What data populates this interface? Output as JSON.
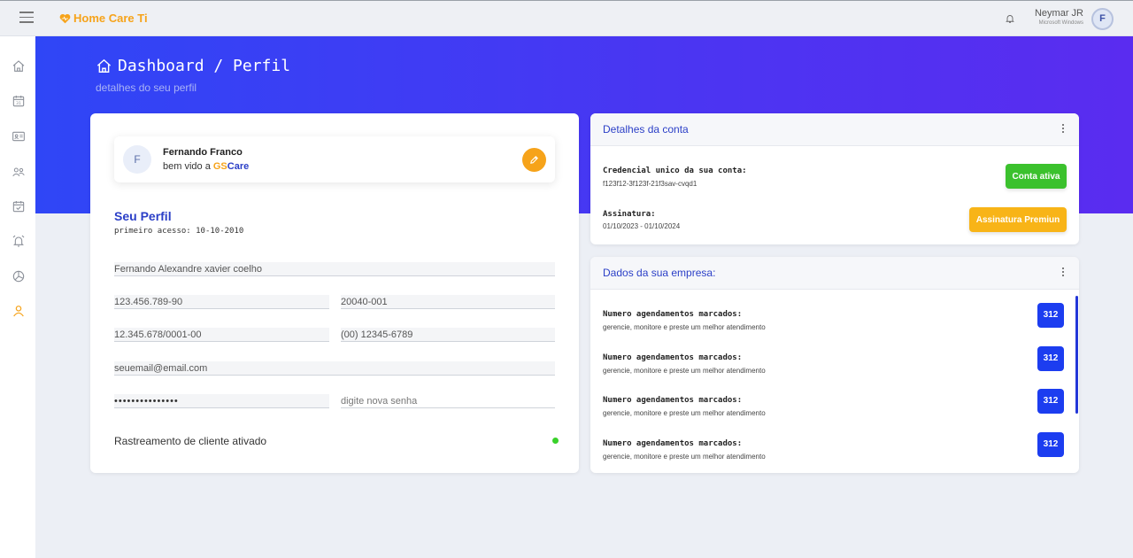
{
  "app": {
    "brand": "Home Care Ti"
  },
  "user": {
    "name": "Neymar JR",
    "subtitle": "Microsoft Windows",
    "avatar_letter": "F"
  },
  "sidebar": {
    "items": [
      {
        "icon": "home-icon"
      },
      {
        "icon": "calendar-icon"
      },
      {
        "icon": "id-card-icon"
      },
      {
        "icon": "users-icon"
      },
      {
        "icon": "calendar-check-icon"
      },
      {
        "icon": "alarm-icon"
      },
      {
        "icon": "chart-pie-icon"
      },
      {
        "icon": "user-icon",
        "active": true
      }
    ]
  },
  "hero": {
    "title": "Dashboard / Perfil",
    "subtitle": "detalhes do seu perfil"
  },
  "profile": {
    "avatar_letter": "F",
    "name": "Fernando Franco",
    "welcome_prefix": "bem vido a ",
    "brand_gs": "GS",
    "brand_care": "Care",
    "section_title": "Seu Perfil",
    "first_access": "primeiro acesso: 10-10-2010",
    "fields": {
      "full_name": "Fernando Alexandre xavier coelho",
      "cpf": "123.456.789-90",
      "cep": "20040-001",
      "cnpj": "12.345.678/0001-00",
      "phone": "(00) 12345-6789",
      "email": "seuemail@email.com",
      "password": "•••••••••••••••",
      "new_password_placeholder": "digite nova senha"
    },
    "tracking_label": "Rastreamento de cliente ativado"
  },
  "account": {
    "title": "Detalhes da conta",
    "credential_label": "Credencial unico da sua conta:",
    "credential_value": "f123f12-3f123f-21f3sav-cvqd1",
    "status_button": "Conta ativa",
    "subscription_label": "Assinatura:",
    "subscription_value": "01/10/2023 - 01/10/2024",
    "subscription_button": "Assinatura Premiun"
  },
  "company": {
    "title": "Dados da sua empresa:",
    "rows": [
      {
        "label": "Numero agendamentos marcados:",
        "desc": "gerencie, monitore e preste um melhor atendimento",
        "value": "312"
      },
      {
        "label": "Numero agendamentos marcados:",
        "desc": "gerencie, monitore e preste um melhor atendimento",
        "value": "312"
      },
      {
        "label": "Numero agendamentos marcados:",
        "desc": "gerencie, monitore e preste um melhor atendimento",
        "value": "312"
      },
      {
        "label": "Numero agendamentos marcados:",
        "desc": "gerencie, monitore e preste um melhor atendimento",
        "value": "312"
      }
    ]
  },
  "colors": {
    "primary": "#2b3fc7",
    "accent": "#f6a31a",
    "success": "#3bc12d",
    "hero": "#3a3ef4"
  }
}
